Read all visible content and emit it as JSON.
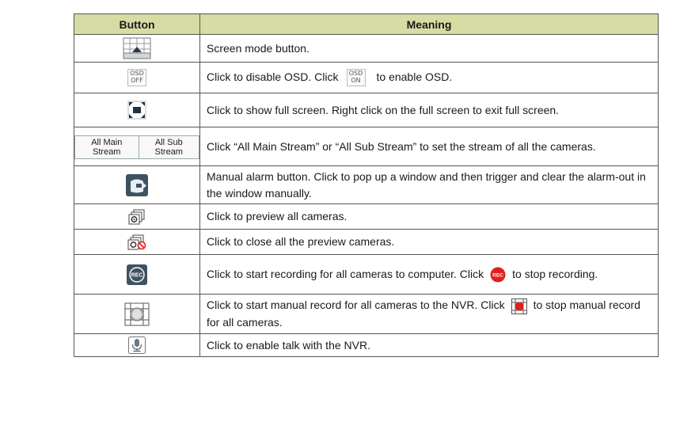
{
  "header": {
    "button": "Button",
    "meaning": "Meaning"
  },
  "rows": [
    {
      "icon": "screen-mode-icon",
      "text": "Screen mode button."
    },
    {
      "icon": "osd-off-icon",
      "icon_text": [
        "OSD",
        "OFF"
      ],
      "text_a": "Click to disable OSD. Click",
      "inline_icon": "osd-on-icon",
      "inline_text": [
        "OSD",
        "ON"
      ],
      "text_b": "to enable OSD."
    },
    {
      "icon": "fullscreen-icon",
      "text": "Click to show full screen. Right click on the full screen to exit full screen."
    },
    {
      "icon": "stream-buttons",
      "stream_labels": [
        "All Main Stream",
        "All Sub Stream"
      ],
      "text": "Click “All Main Stream” or “All Sub Stream” to set the stream of all the cameras."
    },
    {
      "icon": "manual-alarm-icon",
      "text": "Manual alarm button. Click to pop up a window and then trigger and clear the alarm-out in the window manually."
    },
    {
      "icon": "preview-all-icon",
      "text": "Click to preview all cameras."
    },
    {
      "icon": "close-preview-icon",
      "text": "Click to close all the preview cameras."
    },
    {
      "icon": "rec-icon",
      "icon_text": "REC",
      "text_a": "Click to start recording for all cameras to computer. Click",
      "inline_icon": "rec-stop-icon",
      "inline_text": "REC",
      "text_b": "to stop recording."
    },
    {
      "icon": "manual-record-icon",
      "text_a": "Click to start manual record for all cameras to the NVR. Click",
      "inline_icon": "manual-record-stop-icon",
      "text_b": "to stop manual record for all cameras."
    },
    {
      "icon": "talk-icon",
      "text": "Click to enable talk with the NVR."
    }
  ]
}
